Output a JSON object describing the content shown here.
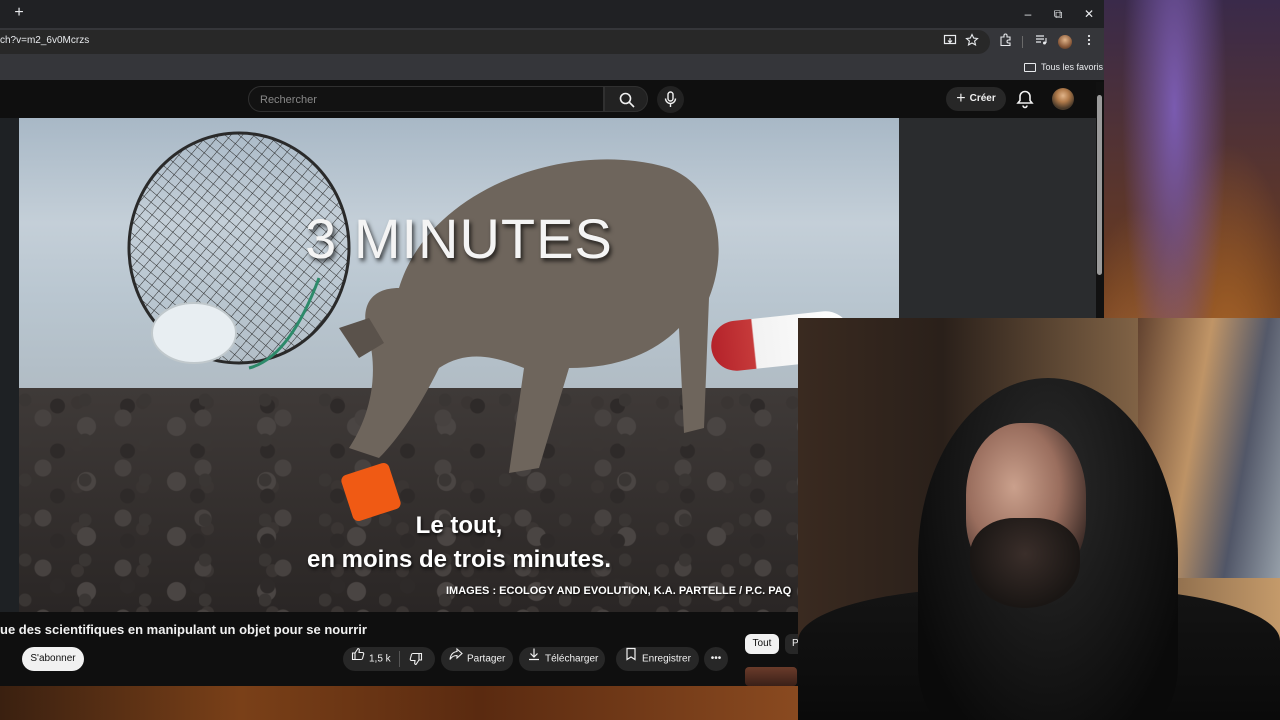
{
  "browser": {
    "url": "ch?v=m2_6v0Mcrzs",
    "bookmarks_folder": "Tous les favoris",
    "window_controls": {
      "minimize": "–",
      "restore": "⧉",
      "close": "✕"
    },
    "new_tab": "+"
  },
  "youtube": {
    "search_placeholder": "Rechercher",
    "create_label": "Créer",
    "create_plus": "+"
  },
  "video": {
    "overlay_title": "3 MINUTES",
    "caption_line1": "Le tout,",
    "caption_line2": "en moins de trois minutes.",
    "credit": "IMAGES : ECOLOGY AND EVOLUTION, K.A. PARTELLE / P.C. PAQ"
  },
  "meta": {
    "title": "ue des scientifiques en manipulant un objet pour se nourrir",
    "subscribe_label": "S'abonner",
    "likes": "1,5 k",
    "share_label": "Partager",
    "download_label": "Télécharger",
    "save_label": "Enregistrer",
    "more_label": "•••"
  },
  "sidebar_chips": {
    "all_label": "Tout",
    "next_label": "P"
  },
  "colors": {
    "youtube_bg": "#0f0f0f",
    "chrome_toolbar": "#35363a",
    "pill_bg": "#272727",
    "subscribe_bg": "#f1f1f1"
  }
}
